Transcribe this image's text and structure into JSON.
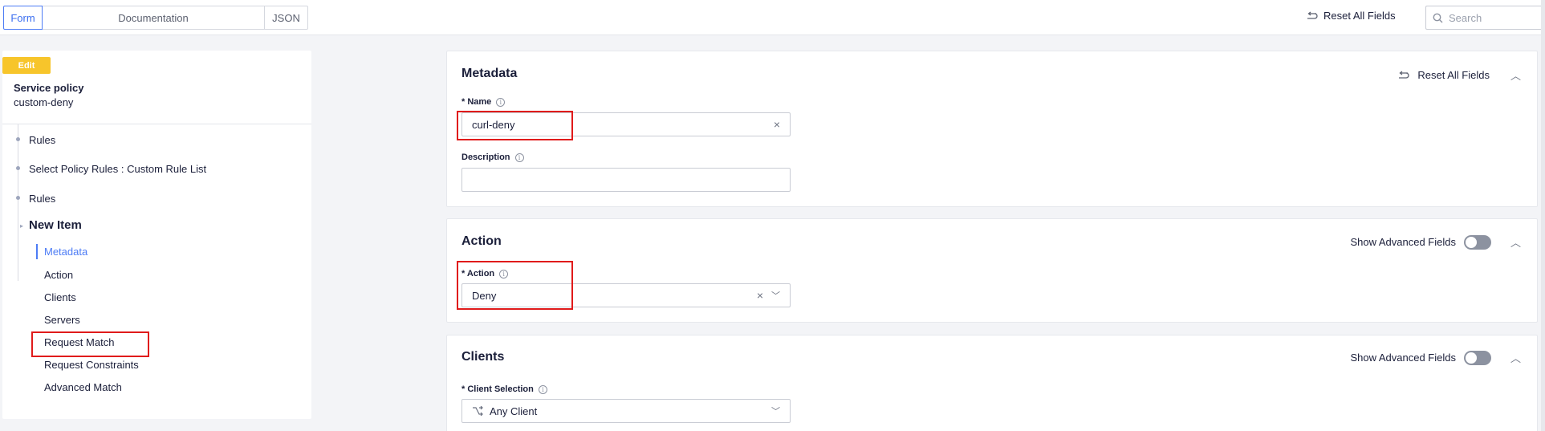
{
  "topbar": {
    "tabs": [
      {
        "label": "Form"
      },
      {
        "label": "Documentation"
      },
      {
        "label": "JSON"
      }
    ],
    "reset_label": "Reset All Fields",
    "search_placeholder": "Search"
  },
  "sidebar": {
    "badge": "Edit",
    "object_type": "Service policy",
    "object_name": "custom-deny",
    "breadcrumbs": [
      {
        "label": "Rules"
      },
      {
        "label": "Select Policy Rules : Custom Rule List"
      },
      {
        "label": "Rules"
      }
    ],
    "new_item": "New Item",
    "items": [
      {
        "label": "Metadata"
      },
      {
        "label": "Action"
      },
      {
        "label": "Clients"
      },
      {
        "label": "Servers"
      },
      {
        "label": "Request Match"
      },
      {
        "label": "Request Constraints"
      },
      {
        "label": "Advanced Match"
      }
    ]
  },
  "metadata": {
    "title": "Metadata",
    "reset_label": "Reset All Fields",
    "name_label": "* Name",
    "name_value": "curl-deny",
    "description_label": "Description",
    "description_value": ""
  },
  "action": {
    "title": "Action",
    "advanced_label": "Show Advanced Fields",
    "field_label": "* Action",
    "field_value": "Deny"
  },
  "clients": {
    "title": "Clients",
    "advanced_label": "Show Advanced Fields",
    "field_label": "* Client Selection",
    "field_value": "Any Client"
  },
  "colors": {
    "accent": "#4d7cf5",
    "badge": "#f7c52b",
    "highlight": "#e01b1b"
  }
}
